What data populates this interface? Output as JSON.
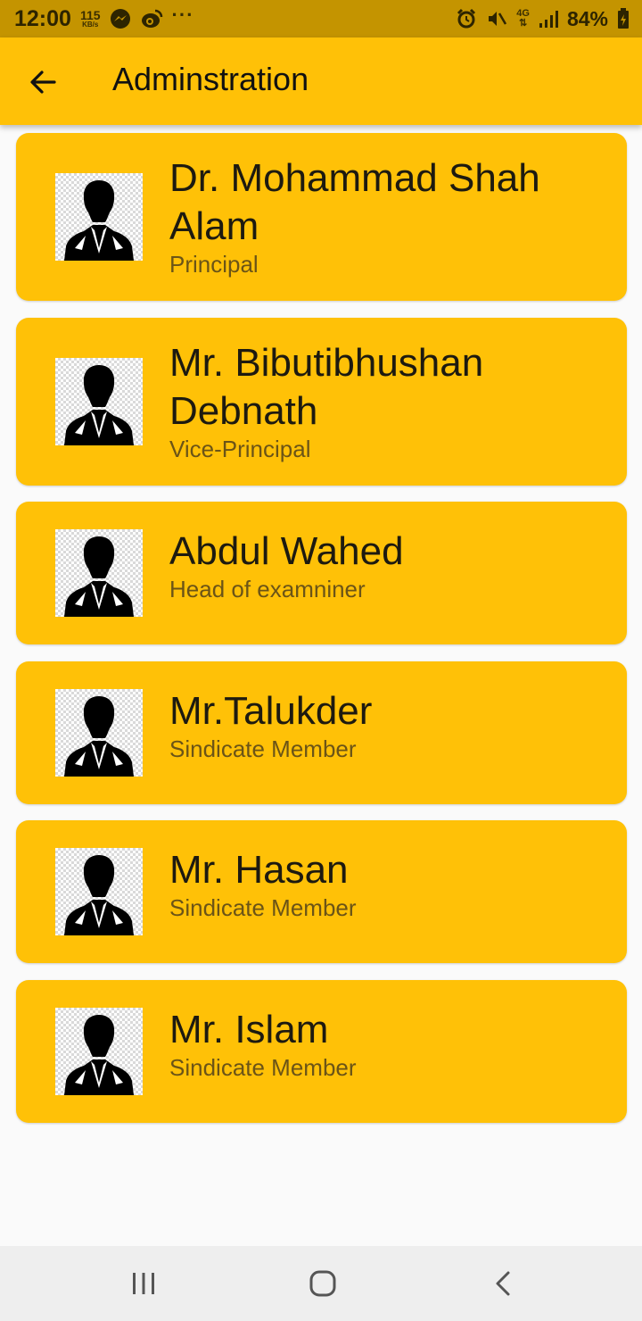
{
  "status_bar": {
    "time": "12:00",
    "speed_value": "115",
    "speed_unit": "KB/s",
    "more": "···",
    "network": "4G",
    "battery": "84%"
  },
  "app_bar": {
    "title": "Adminstration",
    "back_icon": "arrow-left-icon"
  },
  "members": [
    {
      "name": "Dr. Mohammad Shah Alam",
      "role": "Principal"
    },
    {
      "name": "Mr. Bibutibhushan Debnath",
      "role": "Vice-Principal"
    },
    {
      "name": "Abdul Wahed",
      "role": "Head of examniner"
    },
    {
      "name": "Mr.Talukder",
      "role": "Sindicate Member"
    },
    {
      "name": "Mr. Hasan",
      "role": "Sindicate Member"
    },
    {
      "name": "Mr. Islam",
      "role": "Sindicate Member"
    }
  ],
  "nav_bar": {
    "recents_icon": "recents-icon",
    "home_icon": "home-icon",
    "back_icon": "back-chevron-icon"
  },
  "colors": {
    "accent": "#ffc107",
    "status_bar": "#c49400",
    "background": "#fafafa"
  }
}
